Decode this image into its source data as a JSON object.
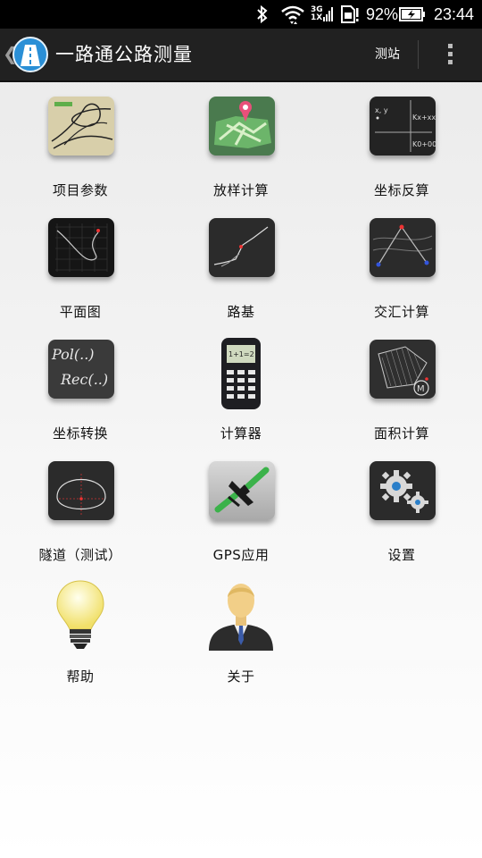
{
  "status_bar": {
    "network_top": "3G",
    "network_bottom": "1X",
    "battery": "92%",
    "time": "23:44"
  },
  "action_bar": {
    "title": "一路通公路测量",
    "station_button": "测站"
  },
  "grid": {
    "items": [
      {
        "label": "项目参数",
        "icon": "highway-interchange-icon"
      },
      {
        "label": "放样计算",
        "icon": "map-pin-icon"
      },
      {
        "label": "坐标反算",
        "icon": "coordinate-axes-icon"
      },
      {
        "label": "平面图",
        "icon": "plan-curve-icon"
      },
      {
        "label": "路基",
        "icon": "profile-line-icon"
      },
      {
        "label": "交汇计算",
        "icon": "intersection-icon"
      },
      {
        "label": "坐标转换",
        "icon": "pol-rec-icon"
      },
      {
        "label": "计算器",
        "icon": "calculator-icon"
      },
      {
        "label": "面积计算",
        "icon": "area-polygon-icon"
      },
      {
        "label": "隧道（测试）",
        "icon": "tunnel-section-icon"
      },
      {
        "label": "GPS应用",
        "icon": "satellite-icon"
      },
      {
        "label": "设置",
        "icon": "gears-icon"
      },
      {
        "label": "帮助",
        "icon": "lightbulb-icon"
      },
      {
        "label": "关于",
        "icon": "person-icon"
      }
    ],
    "tile_text": {
      "xy": "x, y",
      "kx": "Kx+xx",
      "k0": "K0+00",
      "pol": "Pol(..)",
      "rec": "Rec(..)",
      "calc_screen": "1+1=2",
      "area_m": "M"
    }
  },
  "colors": {
    "action_bar": "#212121",
    "accent_blue": "#2a8fd6",
    "map_green": "#6cb56a",
    "pin_red": "#e8507a"
  }
}
